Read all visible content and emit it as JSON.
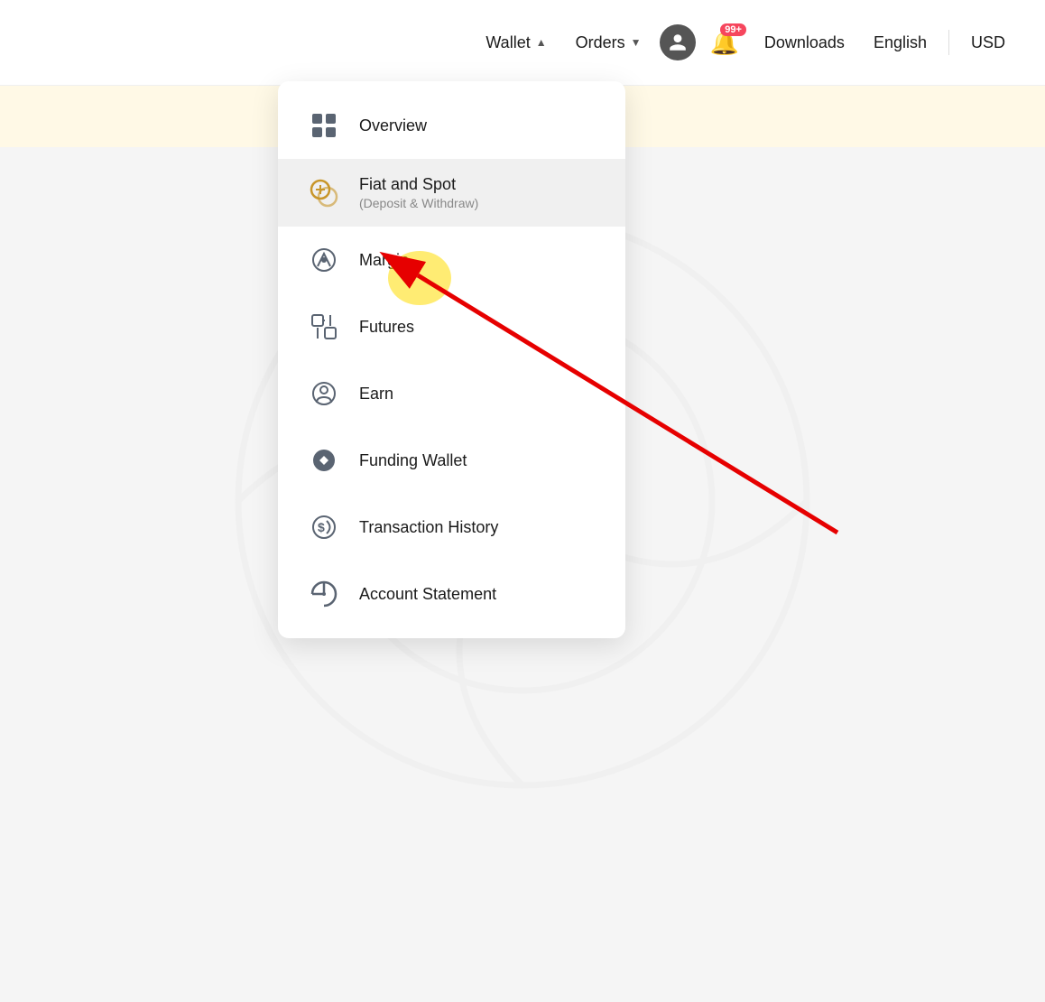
{
  "nav": {
    "wallet_label": "Wallet",
    "orders_label": "Orders",
    "downloads_label": "Downloads",
    "english_label": "English",
    "usd_label": "USD",
    "notification_badge": "99+",
    "wallet_chevron": "▲",
    "orders_chevron": "▼"
  },
  "menu": {
    "items": [
      {
        "id": "overview",
        "label": "Overview",
        "sublabel": "",
        "icon": "grid-icon"
      },
      {
        "id": "fiat-and-spot",
        "label": "Fiat and Spot",
        "sublabel": "(Deposit & Withdraw)",
        "icon": "fiat-spot-icon",
        "highlighted": true
      },
      {
        "id": "margin",
        "label": "Margin",
        "sublabel": "",
        "icon": "margin-icon"
      },
      {
        "id": "futures",
        "label": "Futures",
        "sublabel": "",
        "icon": "futures-icon"
      },
      {
        "id": "earn",
        "label": "Earn",
        "sublabel": "",
        "icon": "earn-icon"
      },
      {
        "id": "funding-wallet",
        "label": "Funding Wallet",
        "sublabel": "",
        "icon": "funding-wallet-icon"
      },
      {
        "id": "transaction-history",
        "label": "Transaction History",
        "sublabel": "",
        "icon": "transaction-history-icon"
      },
      {
        "id": "account-statement",
        "label": "Account Statement",
        "sublabel": "",
        "icon": "account-statement-icon"
      }
    ]
  }
}
